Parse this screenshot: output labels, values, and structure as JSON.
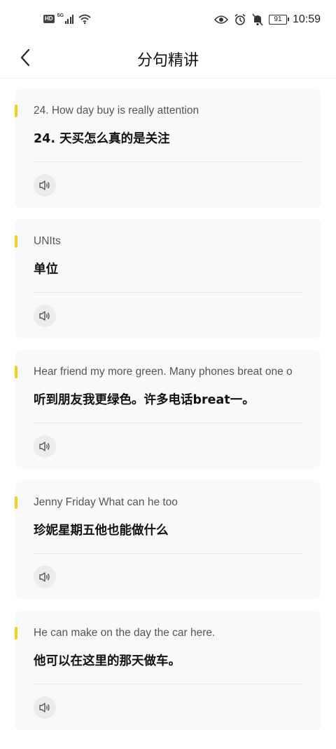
{
  "status_bar": {
    "hd": "HD",
    "network": "5G",
    "battery": "91",
    "time": "10:59",
    "icons": [
      "signal-icon",
      "wifi-icon",
      "eye-icon",
      "alarm-icon",
      "mute-icon",
      "battery-icon"
    ]
  },
  "header": {
    "title": "分句精讲",
    "back_icon": "chevron-left-icon"
  },
  "accent_color": "#f5cf1d",
  "sentences": [
    {
      "en": "24. How day buy is really attention",
      "zh": "24. 天买怎么真的是关注"
    },
    {
      "en": "UNIts",
      "zh": "单位"
    },
    {
      "en": "Hear friend my more green. Many phones breat one o",
      "zh": "听到朋友我更绿色。许多电话breat一。"
    },
    {
      "en": "Jenny Friday What can he too",
      "zh": "珍妮星期五他也能做什么"
    },
    {
      "en": "He can make on the day the car here.",
      "zh": "他可以在这里的那天做车。"
    }
  ]
}
